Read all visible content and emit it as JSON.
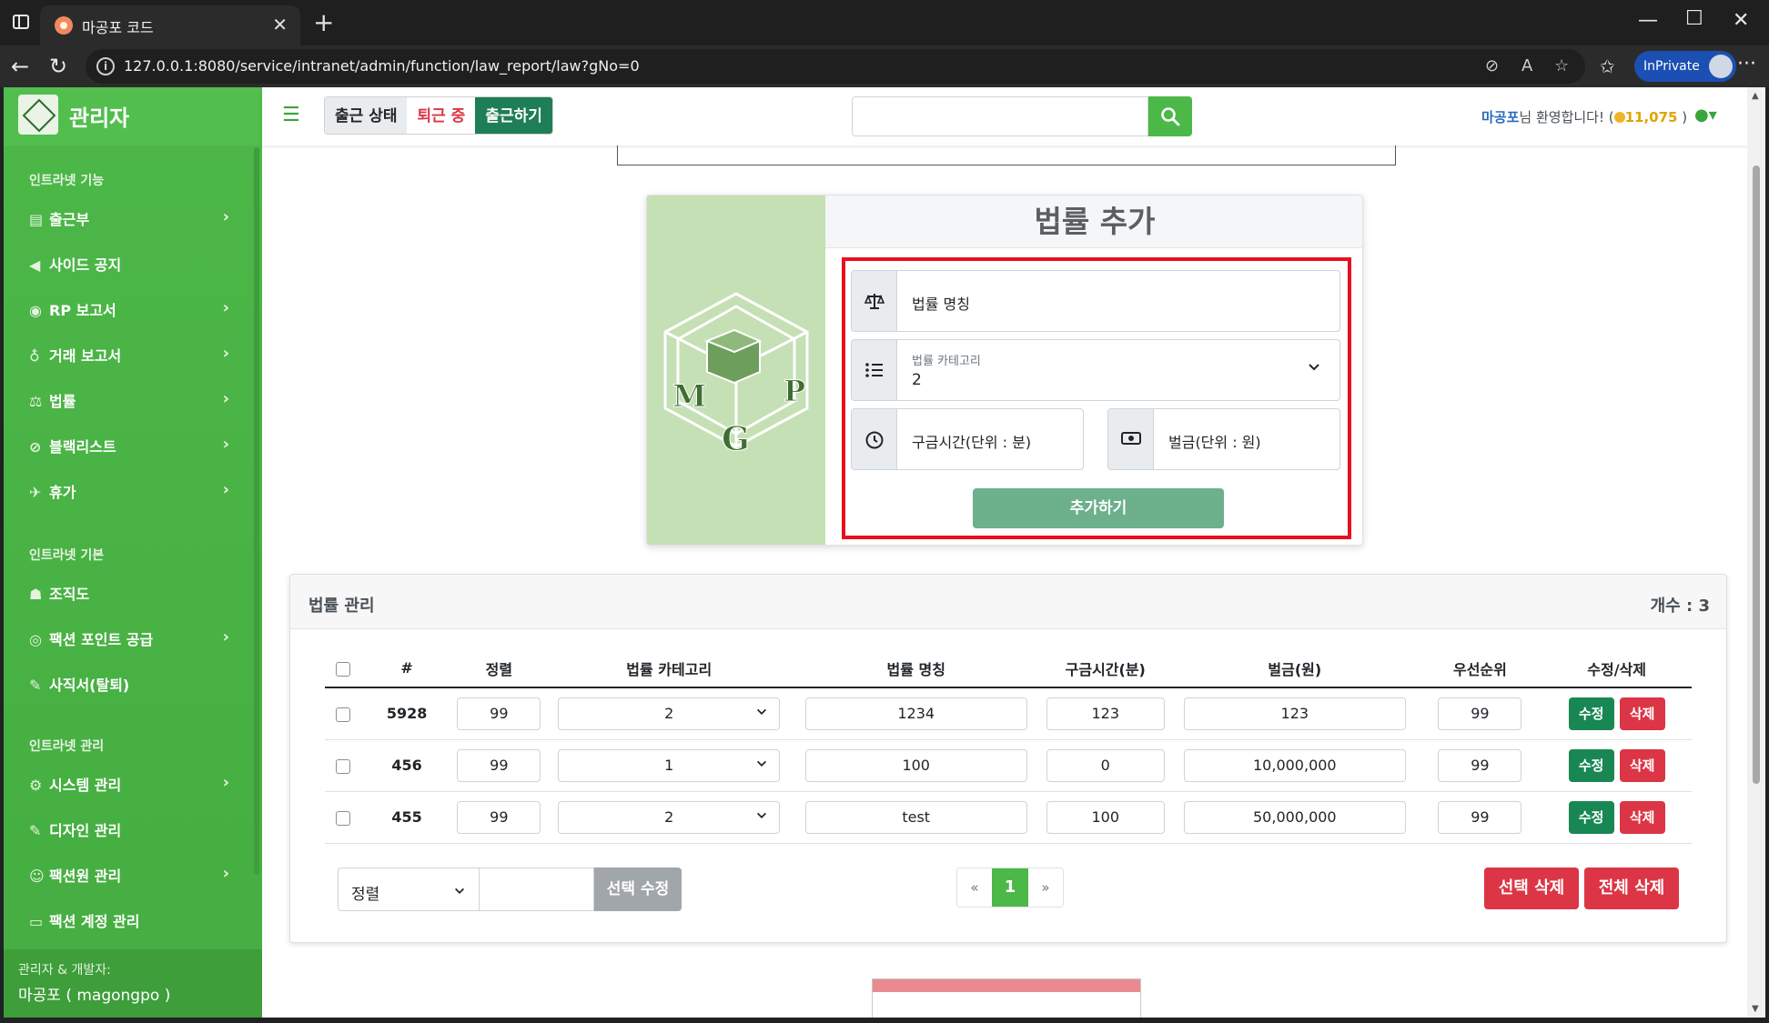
{
  "browser": {
    "tab_title": "마공포 코드",
    "url": "127.0.0.1:8080/service/intranet/admin/function/law_report/law?gNo=0",
    "inprivate_label": "InPrivate"
  },
  "sidebar": {
    "brand": "관리자",
    "sections": [
      {
        "heading": "인트라넷 기능",
        "items": [
          {
            "label": "출근부",
            "icon": "ledger-icon",
            "chevron": true
          },
          {
            "label": "사이드 공지",
            "icon": "megaphone-icon",
            "chevron": false
          },
          {
            "label": "RP 보고서",
            "icon": "gamepad-icon",
            "chevron": true
          },
          {
            "label": "거래 보고서",
            "icon": "moneybag-icon",
            "chevron": true
          },
          {
            "label": "법률",
            "icon": "scale-icon",
            "chevron": true
          },
          {
            "label": "블랙리스트",
            "icon": "ban-icon",
            "chevron": true
          },
          {
            "label": "휴가",
            "icon": "plane-icon",
            "chevron": true
          }
        ]
      },
      {
        "heading": "인트라넷 기본",
        "items": [
          {
            "label": "조직도",
            "icon": "sitemap-icon",
            "chevron": false
          },
          {
            "label": "팩션 포인트 공급",
            "icon": "coins-icon",
            "chevron": true
          },
          {
            "label": "사직서(탈퇴)",
            "icon": "pen-icon",
            "chevron": false
          }
        ]
      },
      {
        "heading": "인트라넷 관리",
        "items": [
          {
            "label": "시스템 관리",
            "icon": "gear-icon",
            "chevron": true
          },
          {
            "label": "디자인 관리",
            "icon": "brush-icon",
            "chevron": false
          },
          {
            "label": "팩션원 관리",
            "icon": "users-icon",
            "chevron": true
          },
          {
            "label": "팩션 계정 관리",
            "icon": "idcard-icon",
            "chevron": false
          }
        ]
      }
    ],
    "footer_line1": "관리자 & 개발자:",
    "footer_line2": "마공포 ( magongpo )"
  },
  "topbar": {
    "attendance_label": "출근 상태",
    "attendance_status": "퇴근 중",
    "attendance_button": "출근하기",
    "search_value": "",
    "user_name": "마공포",
    "welcome_text": "님 환영합니다! (",
    "points": "11,075",
    "welcome_close": ")"
  },
  "add_form": {
    "title": "법률 추가",
    "name_placeholder": "법률 명칭",
    "category_label": "법률 카테고리",
    "category_value": "2",
    "time_placeholder": "구금시간(단위 : 분)",
    "fine_placeholder": "벌금(단위 : 원)",
    "submit_label": "추가하기",
    "logo_letters": [
      "M",
      "G",
      "P"
    ]
  },
  "manage": {
    "title": "법률 관리",
    "count_text": "개수 : 3",
    "columns": [
      "#",
      "정렬",
      "법률 카테고리",
      "법률 명칭",
      "구금시간(분)",
      "벌금(원)",
      "우선순위",
      "수정/삭제"
    ],
    "rows": [
      {
        "id": "5928",
        "sort": "99",
        "category": "2",
        "name": "1234",
        "time": "123",
        "fine": "123",
        "priority": "99"
      },
      {
        "id": "456",
        "sort": "99",
        "category": "1",
        "name": "100",
        "time": "0",
        "fine": "10,000,000",
        "priority": "99"
      },
      {
        "id": "455",
        "sort": "99",
        "category": "2",
        "name": "test",
        "time": "100",
        "fine": "50,000,000",
        "priority": "99"
      }
    ],
    "edit_label": "수정",
    "delete_label": "삭제",
    "sort_select_value": "정렬",
    "bulk_edit_label": "선택 수정",
    "pager": {
      "prev": "«",
      "current": "1",
      "next": "»"
    },
    "delete_selected_label": "선택 삭제",
    "delete_all_label": "전체 삭제"
  },
  "colors": {
    "sidebar_green": "#4cb848",
    "accent_green": "#198754",
    "danger_red": "#dc3545",
    "highlight_red": "#e8101e"
  }
}
